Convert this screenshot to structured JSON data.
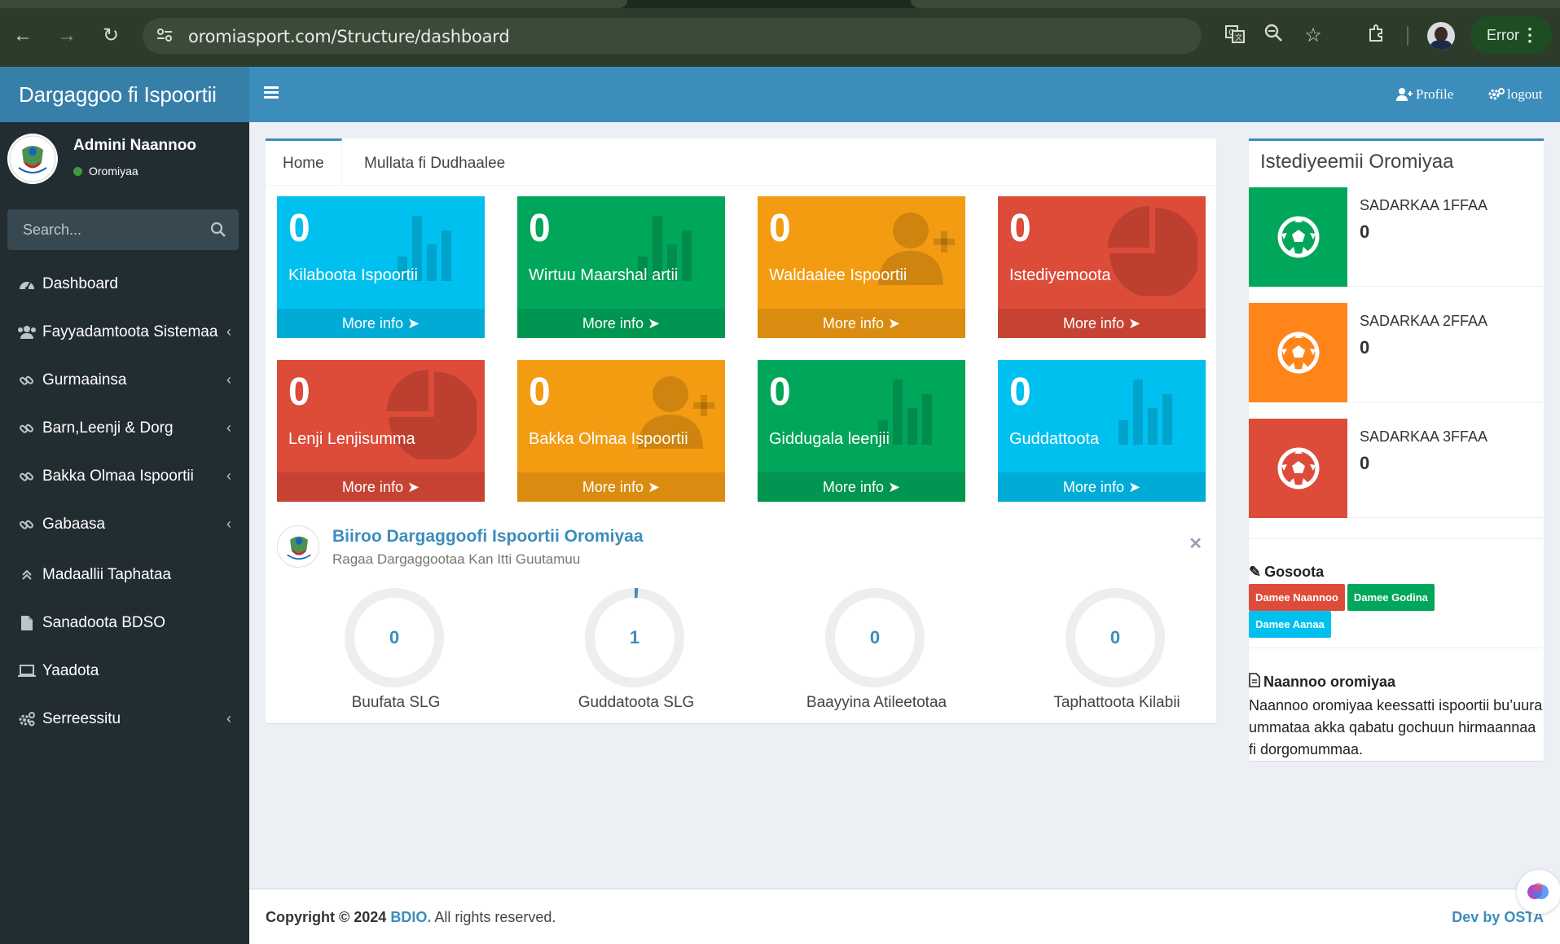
{
  "browser": {
    "url": "oromiasport.com/Structure/dashboard",
    "error_label": "Error"
  },
  "app": {
    "logo_title": "Dargaggoo fi Ispoortii",
    "profile_link": "Profile",
    "logout_link": "logout"
  },
  "user": {
    "name": "Admini Naannoo",
    "status": "Oromiyaa"
  },
  "sidebar": {
    "search_placeholder": "Search...",
    "items": [
      {
        "label": "Dashboard",
        "icon": "dashboard-icon",
        "has_chevron": false
      },
      {
        "label": "Fayyadamtoota Sistemaa",
        "icon": "users-icon",
        "has_chevron": true
      },
      {
        "label": "Gurmaainsa",
        "icon": "link-icon",
        "has_chevron": true
      },
      {
        "label": "Barn,Leenji & Dorg",
        "icon": "link-icon",
        "has_chevron": true
      },
      {
        "label": "Bakka Olmaa Ispoortii",
        "icon": "link-icon",
        "has_chevron": true
      },
      {
        "label": "Gabaasa",
        "icon": "link-icon",
        "has_chevron": true
      },
      {
        "label": "Madaallii Taphataa",
        "icon": "angle-double-up-icon",
        "has_chevron": false
      },
      {
        "label": "Sanadoota BDSO",
        "icon": "file-icon",
        "has_chevron": false
      },
      {
        "label": "Yaadota",
        "icon": "laptop-icon",
        "has_chevron": false
      },
      {
        "label": "Serreessitu",
        "icon": "cogs-icon",
        "has_chevron": true
      }
    ]
  },
  "tabs": [
    {
      "label": "Home",
      "active": true
    },
    {
      "label": "Mullata fi Dudhaalee",
      "active": false
    }
  ],
  "stat_boxes": [
    {
      "value": "0",
      "label": "Kilaboota Ispoortii",
      "color": "#00c0ef",
      "icon": "bar-chart-icon",
      "more": "More info"
    },
    {
      "value": "0",
      "label": "Wirtuu Maarshal artii",
      "color": "#00a65a",
      "icon": "bar-chart-icon",
      "more": "More info"
    },
    {
      "value": "0",
      "label": "Waldaalee Ispoortii",
      "color": "#f39c12",
      "icon": "user-plus-icon",
      "more": "More info"
    },
    {
      "value": "0",
      "label": "Istediyemoota",
      "color": "#dd4b39",
      "icon": "pie-chart-icon",
      "more": "More info"
    },
    {
      "value": "0",
      "label": "Lenji Lenjisumma",
      "color": "#dd4b39",
      "icon": "pie-chart-icon",
      "more": "More info"
    },
    {
      "value": "0",
      "label": "Bakka Olmaa Ispoortii",
      "color": "#f39c12",
      "icon": "user-plus-icon",
      "more": "More info"
    },
    {
      "value": "0",
      "label": "Giddugala leenjii",
      "color": "#00a65a",
      "icon": "bar-chart-icon",
      "more": "More info"
    },
    {
      "value": "0",
      "label": "Guddattoota",
      "color": "#00c0ef",
      "icon": "bar-chart-icon",
      "more": "More info"
    }
  ],
  "office": {
    "title": "Biiroo Dargaggoofi Ispoortii Oromiyaa",
    "subtitle": "Ragaa Dargaggootaa Kan Itti Guutamuu"
  },
  "knobs": [
    {
      "value": "0",
      "label": "Buufata SLG"
    },
    {
      "value": "1",
      "label": "Guddatoota SLG"
    },
    {
      "value": "0",
      "label": "Baayyina Atileetotaa"
    },
    {
      "value": "0",
      "label": "Taphattoota Kilabii"
    }
  ],
  "stadiums": {
    "title": "Istediyeemii Oromiyaa",
    "items": [
      {
        "label": "SADARKAA 1FFAA",
        "value": "0",
        "color": "#00a65a",
        "icon": "soccer-ball-icon"
      },
      {
        "label": "SADARKAA 2FFAA",
        "value": "0",
        "color": "#ff851b",
        "icon": "soccer-ball-icon"
      },
      {
        "label": "SADARKAA 3FFAA",
        "value": "0",
        "color": "#dd4b39",
        "icon": "soccer-ball-icon"
      }
    ]
  },
  "gosoota": {
    "title": "Gosoota",
    "badges": [
      {
        "label": "Damee Naannoo",
        "color": "#dd4b39"
      },
      {
        "label": "Damee Godina",
        "color": "#00a65a"
      },
      {
        "label": "Damee Aanaa",
        "color": "#00c0ef"
      }
    ]
  },
  "naannoo": {
    "title": "Naannoo oromiyaa",
    "text": "Naannoo oromiyaa keessatti ispoortii bu’uura ummataa akka qabatu gochuun hirmaannaa fi dorgomummaa."
  },
  "footer": {
    "copyright_prefix": "Copyright © 2024",
    "org": "BDIO.",
    "rights": "All rights reserved.",
    "dev": "Dev by OSTA"
  }
}
